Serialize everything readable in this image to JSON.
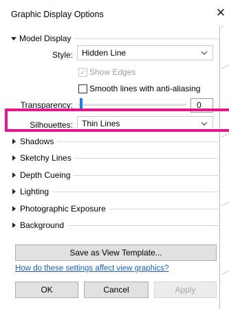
{
  "dialog": {
    "title": "Graphic Display Options",
    "close_icon": "close-icon"
  },
  "model_display": {
    "header": "Model Display",
    "style_label": "Style:",
    "style_value": "Hidden Line",
    "show_edges_label": "Show Edges",
    "show_edges_checked": true,
    "show_edges_disabled": true,
    "smooth_lines_label": "Smooth lines with anti-aliasing",
    "smooth_lines_checked": false,
    "transparency_label": "Transparency:",
    "transparency_value": "0",
    "silhouettes_label": "Silhouettes:",
    "silhouettes_value": "Thin Lines"
  },
  "sections": [
    {
      "label": "Shadows"
    },
    {
      "label": "Sketchy Lines"
    },
    {
      "label": "Depth Cueing"
    },
    {
      "label": "Lighting"
    },
    {
      "label": "Photographic Exposure"
    },
    {
      "label": "Background"
    }
  ],
  "actions": {
    "save_template_label": "Save as View Template...",
    "help_link": "How do these settings affect view graphics?",
    "ok_label": "OK",
    "cancel_label": "Cancel",
    "apply_label": "Apply"
  },
  "colors": {
    "highlight": "#e4168f",
    "slider_accent": "#1d7de1",
    "link": "#1a5fb4"
  }
}
